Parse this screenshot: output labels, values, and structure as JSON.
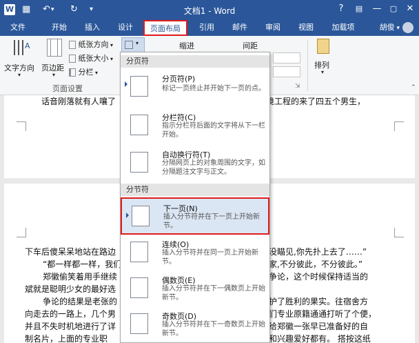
{
  "titlebar": {
    "app_letter": "W",
    "title": "文档1 - Word",
    "help": "?",
    "minimize": "—",
    "restore": "▢",
    "close": "✕"
  },
  "tabs": [
    {
      "label": "文件"
    },
    {
      "label": "开始"
    },
    {
      "label": "插入"
    },
    {
      "label": "设计"
    },
    {
      "label": "页面布局"
    },
    {
      "label": "引用"
    },
    {
      "label": "邮件"
    },
    {
      "label": "审阅"
    },
    {
      "label": "视图"
    },
    {
      "label": "加载项"
    }
  ],
  "user": {
    "name": "胡俊"
  },
  "ribbon": {
    "text_direction": "文字方向",
    "margins": "页边距",
    "orientation": "纸张方向",
    "size": "纸张大小",
    "columns": "分栏",
    "indent": "缩进",
    "spacing": "间距",
    "arrange": "排列",
    "group_page_setup": "页面设置",
    "partial_char": "符"
  },
  "dropdown": {
    "section_page_breaks": "分页符",
    "section_section_breaks": "分节符",
    "items": [
      {
        "title": "分页符(P)",
        "desc": "标记一页终止并开始下一页的点。"
      },
      {
        "title": "分栏符(C)",
        "desc": "指示分栏符后面的文字将从下一栏开始。"
      },
      {
        "title": "自动换行符(T)",
        "desc": "分隔网页上的对象周围的文字，如分隔题注文字与正文。"
      },
      {
        "title": "下一页(N)",
        "desc": "插入分节符并在下一页上开始新节。"
      },
      {
        "title": "连续(O)",
        "desc": "插入分节符并在同一页上开始新节。"
      },
      {
        "title": "偶数页(E)",
        "desc": "插入分节符并在下一偶数页上开始新节。"
      },
      {
        "title": "奇数页(D)",
        "desc": "插入分节符并在下一奇数页上开始新节。"
      }
    ]
  },
  "document": {
    "line1_left": "话音刚落就有人嚷了",
    "line1_right": "境工程的来了四五个男生，",
    "lines_left": [
      "下车后傻呆呆地站在路边",
      "“都一样都一样，我们",
      "郑徽偷笑着用手继续",
      "斌就是聪明少女的最好选",
      "争论的结果是老张的",
      "向走去的一路上，几个男",
      "并且不失时机地进行了详",
      "制名片，上面的专业职"
    ],
    "lines_right": [
      "没瞄见,你先扑上去了……”",
      "家,不分彼此，不分彼此。”",
      "争论，这个时候保持适当的",
      "",
      "护了胜利的果实。往宿舍方",
      "们专业原籍通通打听了个便，",
      "给郑徽一张早已准备好的自",
      "和兴趣爱好都有。 搭按这纸"
    ]
  }
}
